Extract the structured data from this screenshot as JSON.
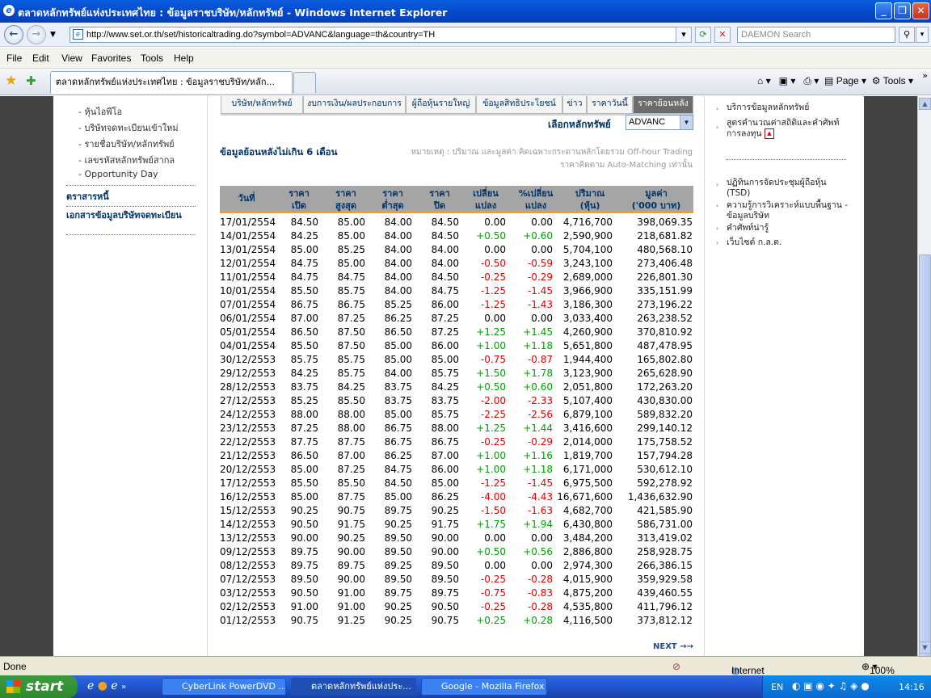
{
  "window": {
    "title": "ตลาดหลักทรัพย์แห่งประเทศไทย : ข้อมูลราชบริษัท/หลักทรัพย์ - Windows Internet Explorer"
  },
  "address": {
    "url": "http://www.set.or.th/set/historicaltrading.do?symbol=ADVANC&language=th&country=TH",
    "search_placeholder": "DAEMON Search"
  },
  "menu": [
    "File",
    "Edit",
    "View",
    "Favorites",
    "Tools",
    "Help"
  ],
  "tab": {
    "label": "ตลาดหลักทรัพย์แห่งประเทศไทย : ข้อมูลราชบริษัท/หลัก..."
  },
  "toolbar": {
    "page": "Page",
    "tools": "Tools"
  },
  "leftnav": {
    "items": [
      "หุ้นไอพีโอ",
      "บริษัทจดทะเบียนเข้าใหม่",
      "รายชื่อบริษัท/หลักทรัพย์",
      "เลขรหัสหลักทรัพย์สากล",
      "Opportunity Day"
    ],
    "section1": "ตราสารหนี้",
    "section2": "เอกสารข้อมูลบริษัทจดทะเบียน"
  },
  "subtabs": [
    "บริษัท/หลักทรัพย์",
    "งบการเงิน/ผลประกอบการ",
    "ผู้ถือหุ้นรายใหญ่",
    "ข้อมูลสิทธิประโยชน์",
    "ข่าว",
    "ราคาวันนี้",
    "ราคาย้อนหลัง"
  ],
  "selector": {
    "label": "เลือกหลักทรัพย์",
    "value": "ADVANC"
  },
  "history_note": "ข้อมูลย้อนหลังไม่เกิน 6 เดือน",
  "remark": "หมายเหตุ : ปริมาณ และมูลค่า คิดเฉพาะกระดานหลักโดยรวม Off-hour Trading ราคาคิดตาม Auto-Matching เท่านั้น",
  "table": {
    "headers": [
      [
        "วันที่",
        ""
      ],
      [
        "ราคา",
        "เปิด"
      ],
      [
        "ราคา",
        "สูงสุด"
      ],
      [
        "ราคา",
        "ต่ำสุด"
      ],
      [
        "ราคา",
        "ปิด"
      ],
      [
        "เปลี่ยน",
        "แปลง"
      ],
      [
        "%เปลี่ยน",
        "แปลง"
      ],
      [
        "ปริมาณ",
        "(หุ้น)"
      ],
      [
        "มูลค่า",
        "('000 บาท)"
      ]
    ],
    "rows": [
      [
        "17/01/2554",
        "84.50",
        "85.00",
        "84.00",
        "84.50",
        "0.00",
        "0.00",
        "4,716,700",
        "398,069.35"
      ],
      [
        "14/01/2554",
        "84.25",
        "85.00",
        "84.00",
        "84.50",
        "+0.50",
        "+0.60",
        "2,590,900",
        "218,681.82"
      ],
      [
        "13/01/2554",
        "85.00",
        "85.25",
        "84.00",
        "84.00",
        "0.00",
        "0.00",
        "5,704,100",
        "480,568.10"
      ],
      [
        "12/01/2554",
        "84.75",
        "85.00",
        "84.00",
        "84.00",
        "-0.50",
        "-0.59",
        "3,243,100",
        "273,406.48"
      ],
      [
        "11/01/2554",
        "84.75",
        "84.75",
        "84.00",
        "84.50",
        "-0.25",
        "-0.29",
        "2,689,000",
        "226,801.30"
      ],
      [
        "10/01/2554",
        "85.50",
        "85.75",
        "84.00",
        "84.75",
        "-1.25",
        "-1.45",
        "3,966,900",
        "335,151.99"
      ],
      [
        "07/01/2554",
        "86.75",
        "86.75",
        "85.25",
        "86.00",
        "-1.25",
        "-1.43",
        "3,186,300",
        "273,196.22"
      ],
      [
        "06/01/2554",
        "87.00",
        "87.25",
        "86.25",
        "87.25",
        "0.00",
        "0.00",
        "3,033,400",
        "263,238.52"
      ],
      [
        "05/01/2554",
        "86.50",
        "87.50",
        "86.50",
        "87.25",
        "+1.25",
        "+1.45",
        "4,260,900",
        "370,810.92"
      ],
      [
        "04/01/2554",
        "85.50",
        "87.50",
        "85.00",
        "86.00",
        "+1.00",
        "+1.18",
        "5,651,800",
        "487,478.95"
      ],
      [
        "30/12/2553",
        "85.75",
        "85.75",
        "85.00",
        "85.00",
        "-0.75",
        "-0.87",
        "1,944,400",
        "165,802.80"
      ],
      [
        "29/12/2553",
        "84.25",
        "85.75",
        "84.00",
        "85.75",
        "+1.50",
        "+1.78",
        "3,123,900",
        "265,628.90"
      ],
      [
        "28/12/2553",
        "83.75",
        "84.25",
        "83.75",
        "84.25",
        "+0.50",
        "+0.60",
        "2,051,800",
        "172,263.20"
      ],
      [
        "27/12/2553",
        "85.25",
        "85.50",
        "83.75",
        "83.75",
        "-2.00",
        "-2.33",
        "5,107,400",
        "430,830.00"
      ],
      [
        "24/12/2553",
        "88.00",
        "88.00",
        "85.00",
        "85.75",
        "-2.25",
        "-2.56",
        "6,879,100",
        "589,832.20"
      ],
      [
        "23/12/2553",
        "87.25",
        "88.00",
        "86.75",
        "88.00",
        "+1.25",
        "+1.44",
        "3,416,600",
        "299,140.12"
      ],
      [
        "22/12/2553",
        "87.75",
        "87.75",
        "86.75",
        "86.75",
        "-0.25",
        "-0.29",
        "2,014,000",
        "175,758.52"
      ],
      [
        "21/12/2553",
        "86.50",
        "87.00",
        "86.25",
        "87.00",
        "+1.00",
        "+1.16",
        "1,819,700",
        "157,794.28"
      ],
      [
        "20/12/2553",
        "85.00",
        "87.25",
        "84.75",
        "86.00",
        "+1.00",
        "+1.18",
        "6,171,000",
        "530,612.10"
      ],
      [
        "17/12/2553",
        "85.50",
        "85.50",
        "84.50",
        "85.00",
        "-1.25",
        "-1.45",
        "6,975,500",
        "592,278.92"
      ],
      [
        "16/12/2553",
        "85.00",
        "87.75",
        "85.00",
        "86.25",
        "-4.00",
        "-4.43",
        "16,671,600",
        "1,436,632.90"
      ],
      [
        "15/12/2553",
        "90.25",
        "90.75",
        "89.75",
        "90.25",
        "-1.50",
        "-1.63",
        "4,682,700",
        "421,585.90"
      ],
      [
        "14/12/2553",
        "90.50",
        "91.75",
        "90.25",
        "91.75",
        "+1.75",
        "+1.94",
        "6,430,800",
        "586,731.00"
      ],
      [
        "13/12/2553",
        "90.00",
        "90.25",
        "89.50",
        "90.00",
        "0.00",
        "0.00",
        "3,484,200",
        "313,419.02"
      ],
      [
        "09/12/2553",
        "89.75",
        "90.00",
        "89.50",
        "90.00",
        "+0.50",
        "+0.56",
        "2,886,800",
        "258,928.75"
      ],
      [
        "08/12/2553",
        "89.75",
        "89.75",
        "89.25",
        "89.50",
        "0.00",
        "0.00",
        "2,974,300",
        "266,386.15"
      ],
      [
        "07/12/2553",
        "89.50",
        "90.00",
        "89.50",
        "89.50",
        "-0.25",
        "-0.28",
        "4,015,900",
        "359,929.58"
      ],
      [
        "03/12/2553",
        "90.50",
        "91.00",
        "89.75",
        "89.75",
        "-0.75",
        "-0.83",
        "4,875,200",
        "439,460.55"
      ],
      [
        "02/12/2553",
        "91.00",
        "91.00",
        "90.25",
        "90.50",
        "-0.25",
        "-0.28",
        "4,535,800",
        "411,796.12"
      ],
      [
        "01/12/2553",
        "90.75",
        "91.25",
        "90.25",
        "90.75",
        "+0.25",
        "+0.28",
        "4,116,500",
        "373,812.12"
      ]
    ]
  },
  "next": "NEXT",
  "rightnav": {
    "group1": [
      "บริการข้อมูลหลักทรัพย์",
      "สูตรคำนวณค่าสถิติและคำศัพท์การลงทุน"
    ],
    "group2": [
      "ปฏิทินการจัดประชุมผู้ถือหุ้น (TSD)",
      "ความรู้การวิเคราะห์แบบพื้นฐาน - ข้อมูลบริษัท",
      "คำศัพท์น่ารู้",
      "เว็บไซต์ ก.ล.ต."
    ]
  },
  "status": {
    "left": "Done",
    "zone": "Internet",
    "zoom": "100%"
  },
  "taskbar": {
    "start": "start",
    "tasks": [
      "CyberLink PowerDVD ...",
      "ตลาดหลักทรัพย์แห่งประ...",
      "Google - Mozilla Firefox"
    ],
    "lang": "EN",
    "time": "14:16"
  }
}
